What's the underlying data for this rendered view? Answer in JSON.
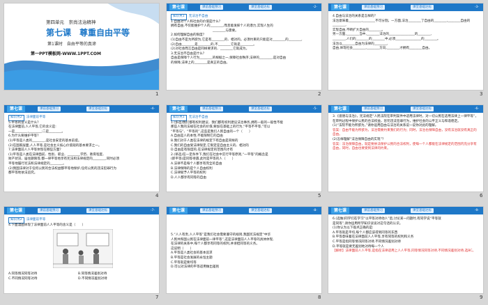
{
  "slides": [
    {
      "num": "1",
      "unit": "第四单元　崇尚法治精神",
      "lesson": "第七课　尊重自由平等",
      "section": "第1课时　自由平等的真谛",
      "site": "第一PPT模板网-WWW.1PPT.COM"
    },
    {
      "num": "2",
      "tag": "第七课",
      "pill1": "课前基础预习",
      "pill2": "课堂基础达标",
      "page": "-2-",
      "point": "知识点1",
      "point_title": "无法治不自由",
      "lines": [
        "1.自由对个人和社会的价值是什么？",
        "拥有自由,不仅能维护个人的________,而且能发挥个人的潜力,实现人生的",
        "________与需要。",
        "2.如何理解自由的限度？",
        "(1)自由不是为所欲为,它是有________的、相对的。必须约束的只能是对________的________,",
        "(2)自由________是________的,不________它就是________。",
        "(2)对社会而言自由是同样要求的、________它就成为。",
        "3.无法治不自由是什么？",
        "自由是保障个人行为________的根据之一,保障社会秩序,法律的________,是对自由",
        "的保障,法律上的________是真正的自由。"
      ]
    },
    {
      "num": "3",
      "tag": "第七课",
      "pill1": "课前基础预习",
      "pill2": "课堂基础达标",
      "page": "-3-",
      "lines": [
        "4.自由与法治的关系是怎样的？",
        "法治意味着________,________不可分割。一方面,法治________了自由的________,________自由的________,",
        "实现自由,不断扩大自由的________。",
        "另一方面,________当中,________法治的________________的________,",
        "________,人们的________的________中,必须________________的________。",
        "法治以________自由为法律的________,",
        "自由,体现社会________,________方向,________才拥有________自由。"
      ]
    },
    {
      "num": "4",
      "tag": "第七课",
      "pill1": "课前基础预习",
      "pill2": "课堂基础达标",
      "page": "-4-",
      "point": "知识点2",
      "point_title": "法律面前平等",
      "lines": [
        "5.平等的含义是什么？",
        "在法律面前,人人平等,它的含义是:",
        "一是________,________;二是________。",
        "6.为什么要维护平等？",
        "(1)平等是人类的________,是社会安定的基本前提。",
        "(2)在国家层面,人人平等,是社会主义核心价值观的基本要求之一。",
        "7.法律面前人人平等体现在哪些方面？",
        "(1)平等是人类在法律面前、性别、职业、________学历、教育程度、",
        "财产状况、居住期限等,都一律平等地享有宪法和法律规定的________,同时必须",
        "平等地履行宪法和法律规定的________。",
        "(2)我国法律对于任何公民的合法权益都平等地保护,任何公民的违法犯罪行为",
        "都平等地依法追究。"
      ]
    },
    {
      "num": "5",
      "tag": "第七课",
      "pill1": "课前基础预习",
      "pill2": "课堂基础达标",
      "page": "-5-",
      "point": "知识点1",
      "point_title": "无法治不自由",
      "lines": [
        "1.(多选)我们都有权利建议、我们都有权利建议法治事务,拥有一般的一般性不能",
        "那些人我的法规在社会的价值,要加在基础上的行为,“平等不平等,”可以",
        "“平等与”、“平等的”,这些是我们人民自由的一个（　　）",
        "A.自由是人的本性,不能限制它的自由",
        "B.我们对于人类在法律的规定下有自由是同样的",
        "C.我们的自由受法律限定,它限定是自由主义的、相对的",
        "D.自由是有限度的,在法律规定的范围内才有",
        "2.(单选)在一定条件下,我们在社会中实行平等原则,“一平等”的概念是",
        "(即平等)是同等待遇,此时是平等的人（　　）",
        "A.法律不是每个人都享有完全的自由",
        "B.法律保障的是个人自由权利",
        "C.法律赋予人平等的权利",
        "D.人人都享有同等的自由"
      ]
    },
    {
      "num": "6",
      "tag": "第七课",
      "pill1": "课前基础预习",
      "pill2": "课堂基础达标",
      "page": "-6-",
      "intro": "3.《道德与法治》，宪法规定“人民法院在审判案件中适用法律时，对一切公民在适用法律上一律平等”，",
      "intro2": "在审判过程中保护公民的合法权益，惩罚违法犯罪行为，维护社会的公平正义与和谐稳定。",
      "q1": "(1)“法院不能为所欲为。”请你运用自由与法治的关系说一说你对此的理解。",
      "a1": "答案：自由不能为所欲为，法治需要约束我们的行为；同时，法治也保障自由，没有法治就没有真正的自由。",
      "q2": "(2)怎样理解“法治保障自由的实现”？",
      "a2": "答案：法治保障自由，就是要依法保护公民的合法权利，使每一个人都能在法律规定的范围内充分享有自由，同时，自由也要受到法律的约束。"
    },
    {
      "num": "7",
      "tag": "第七课",
      "pill1": "课前基础预习",
      "pill2": "课堂基础达标",
      "page": "-7-",
      "point": "知识点2",
      "point_title": "法律面前平等",
      "question": "4.下面漫画体现了法律面前人人平等的含义是（　　）",
      "options": [
        "A.同等情况同等对待",
        "B.同等情况差别对待",
        "C.不同情况同等对待",
        "D.不同情况差别对待"
      ]
    },
    {
      "num": "8",
      "tag": "第七课",
      "pill1": "课前基础预习",
      "pill2": "课堂基础达标",
      "page": "-8-",
      "lines": [
        "5.“人人有责,人人平等”是我们社会需要遵守的规则,我国宪法规定“中华",
        "人民共和国公民在法律面前一律平等”,这是法律面前人人平等的具体体现,",
        "在法律的关系中,每个人都享有同等的权利,并承担同等的义务。",
        "这说明（　　）",
        "A.平等是人类社会的基本追求",
        "B.平等是社会发展的永恒主题",
        "C.平等就是要均等",
        "D.可以对法律的平等适用做出差别"
      ]
    },
    {
      "num": "9",
      "tag": "第七课",
      "pill1": "课前基础预习",
      "pill2": "课堂基础达标",
      "page": "-9-",
      "lines": [
        "6.(选做)同学们在学习“以平等对待他人”后,讨论某一问题时,有同学说“平等就",
        "是同等”,请你运用所学知识谈谈对这句话的认识。",
        "(1)你认为以下观点正确的是:",
        "A.平等就是平均,每个人都应该得到同等的东西",
        "B.平等意味着在法律面前人人平等,享有同等的权利和义务",
        "C.平等是指同等情况同等对待,不同情况差别对待",
        "D.平等就是要无差别地对待每一个人"
      ],
      "answer": "【解析】法律面前人人平等,是指在法律适用上人人平等,同等情况同等对待,不同情况差别对待,选BC。"
    }
  ]
}
